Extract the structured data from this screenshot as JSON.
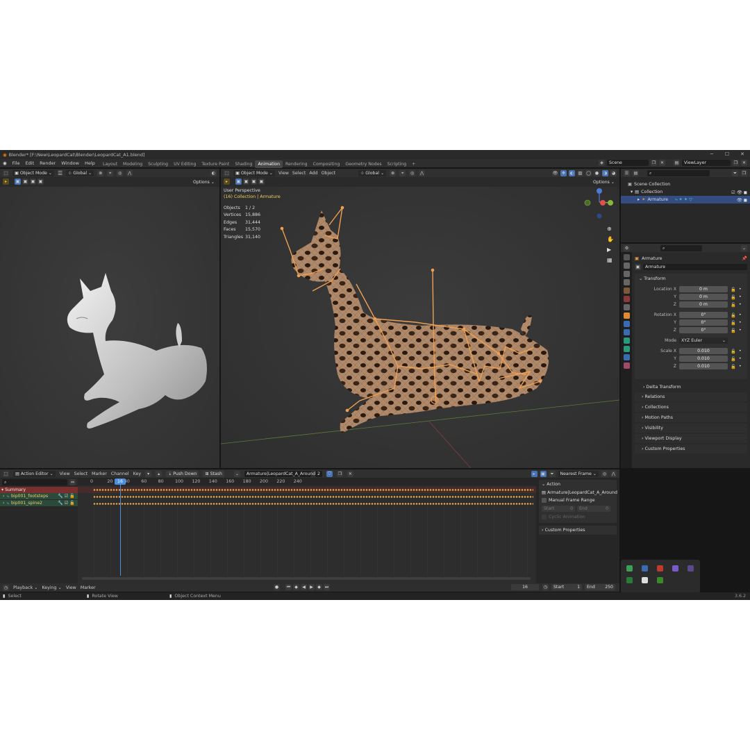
{
  "window": {
    "title": "Blender* [F:\\New\\LeopardCat\\Blender\\LeopardCat_A1.blend]",
    "version": "3.6.2"
  },
  "menu": [
    "File",
    "Edit",
    "Render",
    "Window",
    "Help"
  ],
  "workspaces": [
    "Layout",
    "Modeling",
    "Sculpting",
    "UV Editing",
    "Texture Paint",
    "Shading",
    "Animation",
    "Rendering",
    "Compositing",
    "Geometry Nodes",
    "Scripting"
  ],
  "active_workspace": "Animation",
  "scene": {
    "name": "Scene",
    "view_layer": "ViewLayer"
  },
  "left_viewport": {
    "mode": "Object Mode",
    "orientation": "Global",
    "options": "Options"
  },
  "main_viewport": {
    "mode": "Object Mode",
    "menus": [
      "View",
      "Select",
      "Add",
      "Object"
    ],
    "orientation": "Global",
    "options": "Options",
    "perspective": "User Perspective",
    "collection_line": "(16) Collection | Armature",
    "stats": [
      {
        "label": "Objects",
        "value": "1 / 2"
      },
      {
        "label": "Vertices",
        "value": "15,886"
      },
      {
        "label": "Edges",
        "value": "31,444"
      },
      {
        "label": "Faces",
        "value": "15,570"
      },
      {
        "label": "Triangles",
        "value": "31,140"
      }
    ]
  },
  "outliner": {
    "scene_collection": "Scene Collection",
    "collection": "Collection",
    "armature": "Armature"
  },
  "properties": {
    "object_name": "Armature",
    "data_name": "Armature",
    "transform_title": "Transform",
    "location": [
      {
        "axis": "Location X",
        "value": "0 m"
      },
      {
        "axis": "Y",
        "value": "0 m"
      },
      {
        "axis": "Z",
        "value": "0 m"
      }
    ],
    "rotation": [
      {
        "axis": "Rotation X",
        "value": "0°"
      },
      {
        "axis": "Y",
        "value": "0°"
      },
      {
        "axis": "Z",
        "value": "0°"
      }
    ],
    "mode_label": "Mode",
    "mode_value": "XYZ Euler",
    "scale": [
      {
        "axis": "Scale X",
        "value": "0.010"
      },
      {
        "axis": "Y",
        "value": "0.010"
      },
      {
        "axis": "Z",
        "value": "0.010"
      }
    ],
    "delta": "Delta Transform",
    "panels": [
      "Relations",
      "Collections",
      "Motion Paths",
      "Visibility",
      "Viewport Display",
      "Custom Properties"
    ]
  },
  "action_editor": {
    "editor": "Action Editor",
    "menus": [
      "View",
      "Select",
      "Marker",
      "Channel",
      "Key"
    ],
    "push_down": "Push Down",
    "stash": "Stash",
    "action_name": "Armature|LeopardCat_A_Around",
    "users": "2",
    "snap": "Nearest Frame",
    "frame_ticks": [
      "0",
      "20",
      "40",
      "60",
      "80",
      "100",
      "120",
      "140",
      "160",
      "180",
      "200",
      "220",
      "240"
    ],
    "current_frame": "16",
    "channels": [
      {
        "name": "Summary",
        "type": "summary"
      },
      {
        "name": "bip001_footsteps",
        "type": "group"
      },
      {
        "name": "bip001_spine2",
        "type": "group"
      }
    ],
    "sidebar": {
      "action_title": "Action",
      "action_value": "Armature|LeopardCat_A_Around",
      "manual_range": "Manual Frame Range",
      "start_label": "Start",
      "start_value": "0",
      "end_label": "End",
      "end_value": "0",
      "cyclic": "Cyclic Animation",
      "custom": "Custom Properties"
    }
  },
  "timeline": {
    "menus": [
      "Playback",
      "Keying",
      "View",
      "Marker"
    ],
    "current_frame": "16",
    "start_label": "Start",
    "start_value": "1",
    "end_label": "End",
    "end_value": "250"
  },
  "statusbar": {
    "select": "Select",
    "rotate": "Rotate View",
    "context": "Object Context Menu"
  },
  "colors": {
    "accent": "#4772b3",
    "bone": "#f0a050",
    "active_tab": "#474747",
    "playhead": "#4a8fe0"
  }
}
